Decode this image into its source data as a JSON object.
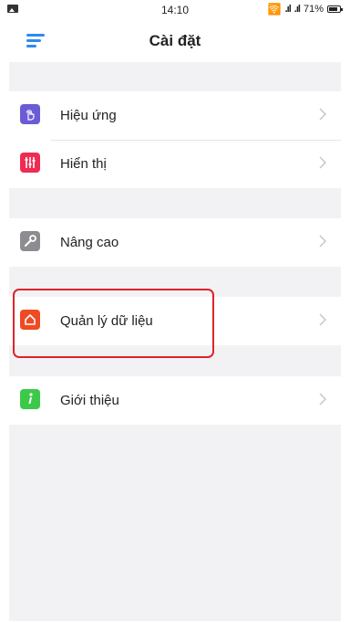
{
  "status_bar": {
    "time": "14:10",
    "battery_percent": "71%",
    "icons": [
      "image-icon",
      "wifi-icon",
      "signal-icon",
      "signal-icon",
      "battery-icon"
    ]
  },
  "header": {
    "title": "Cài đặt",
    "menu_icon": "menu-icon"
  },
  "settings": {
    "items": [
      {
        "label": "Hiệu ứng",
        "icon": "hand-touch-icon",
        "color": "#6a5bd6"
      },
      {
        "label": "Hiển thị",
        "icon": "sliders-icon",
        "color": "#ee2b52"
      },
      {
        "label": "Nâng cao",
        "icon": "wrench-icon",
        "color": "#8b8d91"
      },
      {
        "label": "Quản lý dữ liệu",
        "icon": "home-icon",
        "color": "#f04a23"
      },
      {
        "label": "Giới thiệu",
        "icon": "info-icon",
        "color": "#3cc94a"
      }
    ]
  },
  "colors": {
    "accent": "#2e8bf0",
    "background": "#f2f2f4",
    "highlight": "#e0232a"
  }
}
